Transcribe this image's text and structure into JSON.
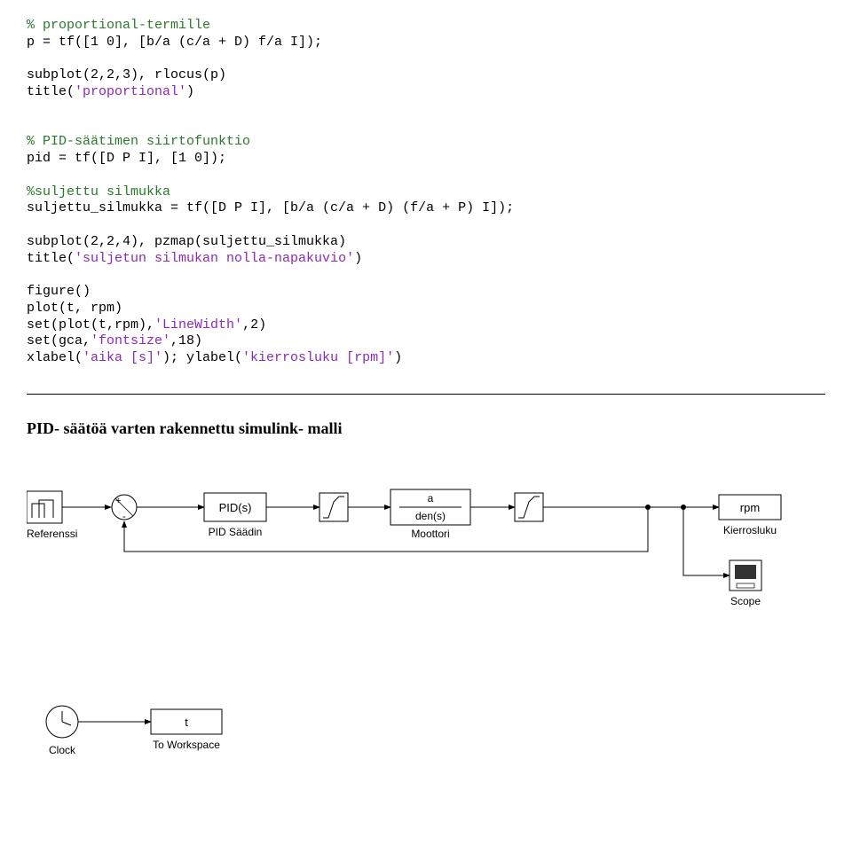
{
  "code": {
    "c1": "% proportional-termille",
    "l1": "p = tf([1 0], [b/a (c/a + D) f/a I]);",
    "l2a": "subplot(2,2,3), rlocus(p)",
    "l2b": "title(",
    "s2b": "'proportional'",
    "l2c": ")",
    "c2": "% PID-säätimen siirtofunktio",
    "l3": "pid = tf([D P I], [1 0]);",
    "c3": "%suljettu silmukka",
    "l4": "suljettu_silmukka = tf([D P I], [b/a (c/a + D) (f/a + P) I]);",
    "l5a": "subplot(2,2,4), pzmap(suljettu_silmukka)",
    "l5b": "title(",
    "s5b": "'suljetun silmukan nolla-napakuvio'",
    "l5c": ")",
    "l6": "figure()",
    "l7": "plot(t, rpm)",
    "l8a": "set(plot(t,rpm),",
    "s8a": "'LineWidth'",
    "l8b": ",2)",
    "l9a": "set(gca,",
    "s9a": "'fontsize'",
    "l9b": ",18)",
    "l10a": "xlabel(",
    "s10a": "'aika [s]'",
    "l10b": "); ylabel(",
    "s10b": "'kierrosluku [rpm]'",
    "l10c": ")"
  },
  "heading": "PID- säätöä varten rakennettu simulink- malli",
  "diagram": {
    "ref_label": "Referenssi",
    "pid_block": "PID(s)",
    "pid_label": "PID Säädin",
    "motor_top": "a",
    "motor_bot": "den(s)",
    "motor_label": "Moottori",
    "rpm_block": "rpm",
    "rpm_label": "Kierrosluku",
    "scope_label": "Scope",
    "t_block": "t",
    "clock_label": "Clock",
    "ws_label": "To Workspace"
  }
}
